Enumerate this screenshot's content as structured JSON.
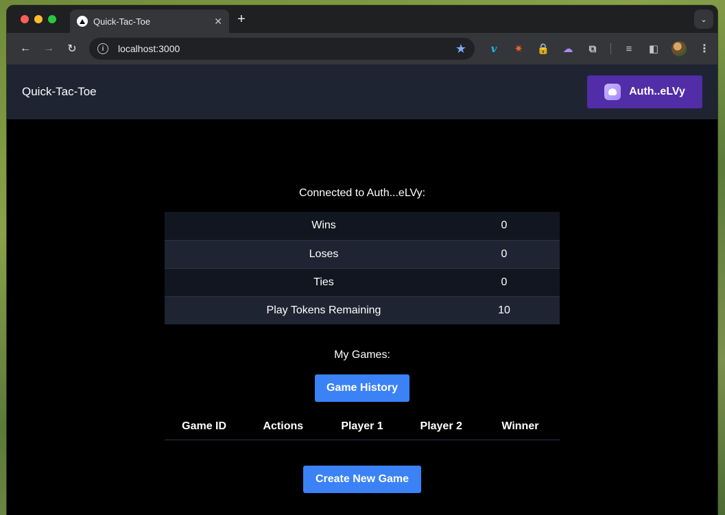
{
  "browser": {
    "tab_title": "Quick-Tac-Toe",
    "tab_close": "✕",
    "new_tab": "+",
    "url": "localhost:3000",
    "nav": {
      "back": "←",
      "forward": "→",
      "reload": "↻"
    },
    "icons": {
      "info": "i",
      "star": "★",
      "vimeo": "v",
      "spark": "✷",
      "lock": "🔒",
      "ghost": "☁",
      "puzzle": "⧉",
      "media": "≡",
      "sidepanel": "◧",
      "menu": "⋮",
      "dropdown": "⌄"
    }
  },
  "app": {
    "brand": "Quick-Tac-Toe",
    "auth_button_label": "Auth..eLVy",
    "connected_text": "Connected to Auth...eLVy:",
    "stats": [
      {
        "label": "Wins",
        "value": "0"
      },
      {
        "label": "Loses",
        "value": "0"
      },
      {
        "label": "Ties",
        "value": "0"
      },
      {
        "label": "Play Tokens Remaining",
        "value": "10"
      }
    ],
    "my_games_label": "My Games:",
    "game_history_button": "Game History",
    "games_columns": [
      "Game ID",
      "Actions",
      "Player 1",
      "Player 2",
      "Winner"
    ],
    "create_game_button": "Create New Game"
  },
  "colors": {
    "header_bg": "#1e2432",
    "auth_button": "#512da8",
    "primary_button": "#3b82f6"
  }
}
